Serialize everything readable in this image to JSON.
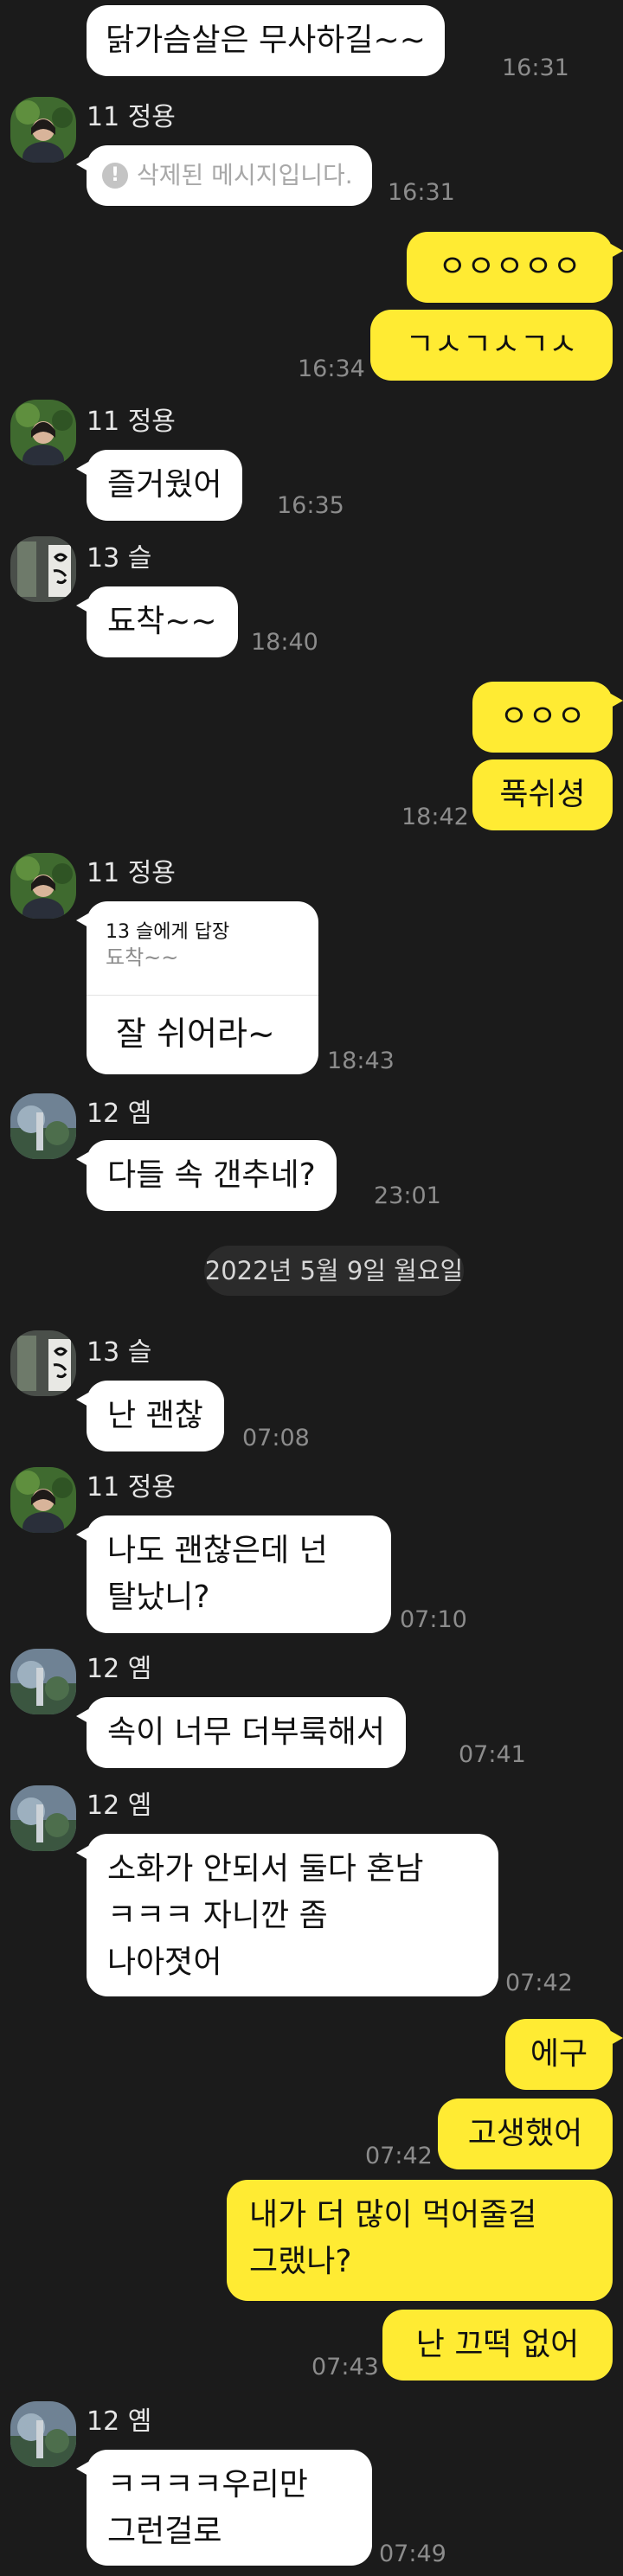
{
  "colors": {
    "background": "#1b1b1b",
    "incoming_bubble": "#ffffff",
    "outgoing_bubble": "#ffeb33",
    "timestamp": "#8c8c8c"
  },
  "msgs": {
    "m1": {
      "text": "닭가슴살은 무사하길~~",
      "time": "16:31"
    },
    "u1": {
      "name": "11 정용"
    },
    "m2": {
      "text": "삭제된 메시지입니다.",
      "time": "16:31",
      "icon": "warning-icon"
    },
    "m3": {
      "text": "ㅇㅇㅇㅇㅇ"
    },
    "m4": {
      "text": "ㄱㅅㄱㅅㄱㅅ",
      "time": "16:34"
    },
    "u2": {
      "name": "11 정용"
    },
    "m5": {
      "text": "즐거웠어",
      "time": "16:35"
    },
    "u3": {
      "name": "13 슬"
    },
    "m6": {
      "text": "됴착~~",
      "time": "18:40"
    },
    "m7": {
      "text": "ㅇㅇㅇ"
    },
    "m8": {
      "text": "푹쉬셩",
      "time": "18:42"
    },
    "u4": {
      "name": "11 정용"
    },
    "m9": {
      "reply_to": "13 슬에게 답장",
      "quoted": "됴착~~",
      "text": "잘 쉬어라~",
      "time": "18:43"
    },
    "u5": {
      "name": "12 옘"
    },
    "m10": {
      "text": "다들 속 갠추네?",
      "time": "23:01"
    },
    "date_divider": "2022년 5월 9일 월요일",
    "u6": {
      "name": "13 슬"
    },
    "m11": {
      "text": "난 괜찮",
      "time": "07:08"
    },
    "u7": {
      "name": "11 정용"
    },
    "m12": {
      "line1": "나도 괜찮은데 넌",
      "line2": "탈났니?",
      "time": "07:10"
    },
    "u8": {
      "name": "12 옘"
    },
    "m13": {
      "text": "속이 너무 더부룩해서",
      "time": "07:41"
    },
    "u9": {
      "name": "12 옘"
    },
    "m14": {
      "line1": "소화가 안되서 둘다 혼남",
      "line2": "ㅋㅋㅋ 자니깐 좀",
      "line3": "나아졋어",
      "time": "07:42"
    },
    "m15": {
      "text": "에구"
    },
    "m16": {
      "text": "고생했어",
      "time": "07:42"
    },
    "m17": {
      "line1": "내가 더 많이 먹어줄걸",
      "line2": "그랬나?"
    },
    "m18": {
      "text": "난 끄떡 없어",
      "time": "07:43"
    },
    "u10": {
      "name": "12 옘"
    },
    "m19": {
      "line1": "ㅋㅋㅋㅋ우리만",
      "line2": "그런걸로",
      "time": "07:49"
    }
  }
}
